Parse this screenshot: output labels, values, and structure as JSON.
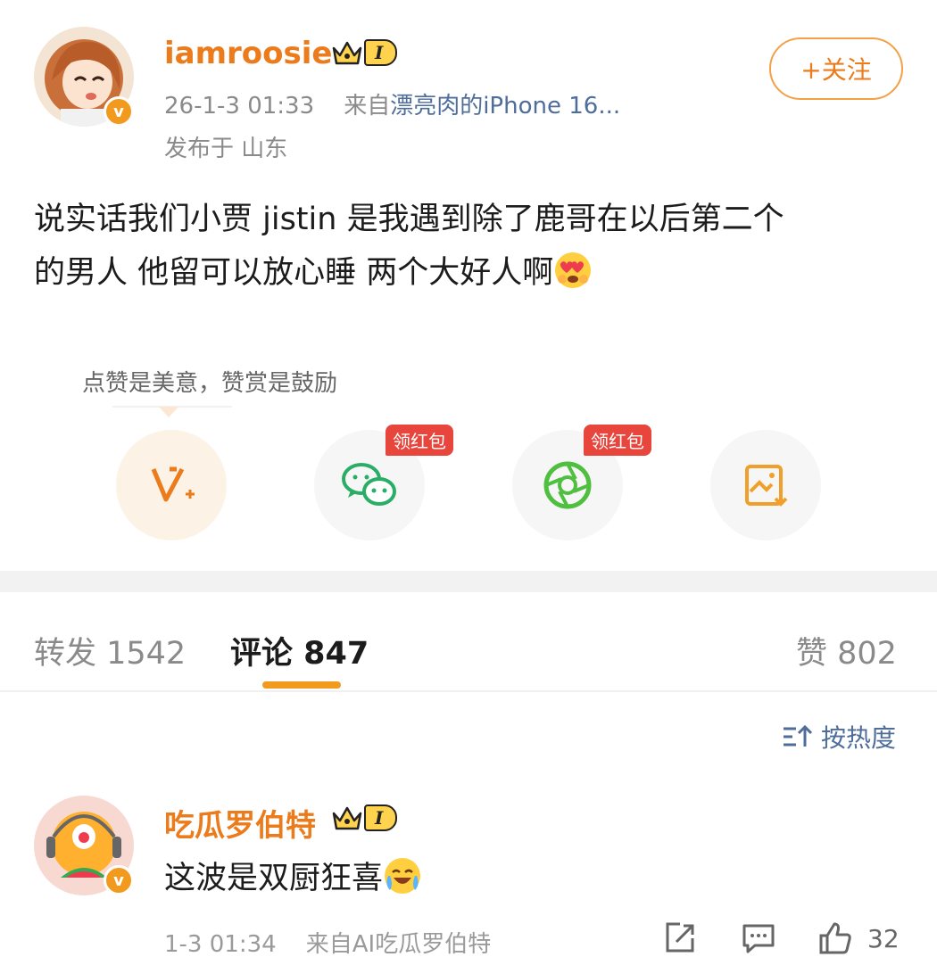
{
  "post": {
    "author": "iamroosie",
    "level": "I",
    "follow_label": "+关注",
    "date": "26-1-3 01:33",
    "source_prefix": "来自",
    "source_name": "漂亮肉的iPhone 16...",
    "location": "发布于 山东",
    "text_line1": "说实话我们小贾 jistin 是我遇到除了鹿哥在以后第二个",
    "text_line2": "的男人 他留可以放心睡 两个大好人啊"
  },
  "reward_tip": "点赞是美意，赞赏是鼓励",
  "actions": [
    {
      "name": "reward",
      "badge": ""
    },
    {
      "name": "wechat",
      "badge": "领红包"
    },
    {
      "name": "moments",
      "badge": "领红包"
    },
    {
      "name": "save-image",
      "badge": ""
    }
  ],
  "tabs": {
    "repost": "转发 1542",
    "comment": "评论 847",
    "like": "赞 802"
  },
  "sort_label": "按热度",
  "comment": {
    "author": "吃瓜罗伯特",
    "level": "I",
    "text": "这波是双厨狂喜",
    "date": "1-3 01:34",
    "source_prefix": "来自",
    "source_name": "AI吃瓜罗伯特",
    "like_count": "32"
  },
  "colors": {
    "accent": "#eb7b1b",
    "link": "#4f6d9a",
    "badge_red": "#e8453c",
    "wechat_green": "#2aae67"
  }
}
